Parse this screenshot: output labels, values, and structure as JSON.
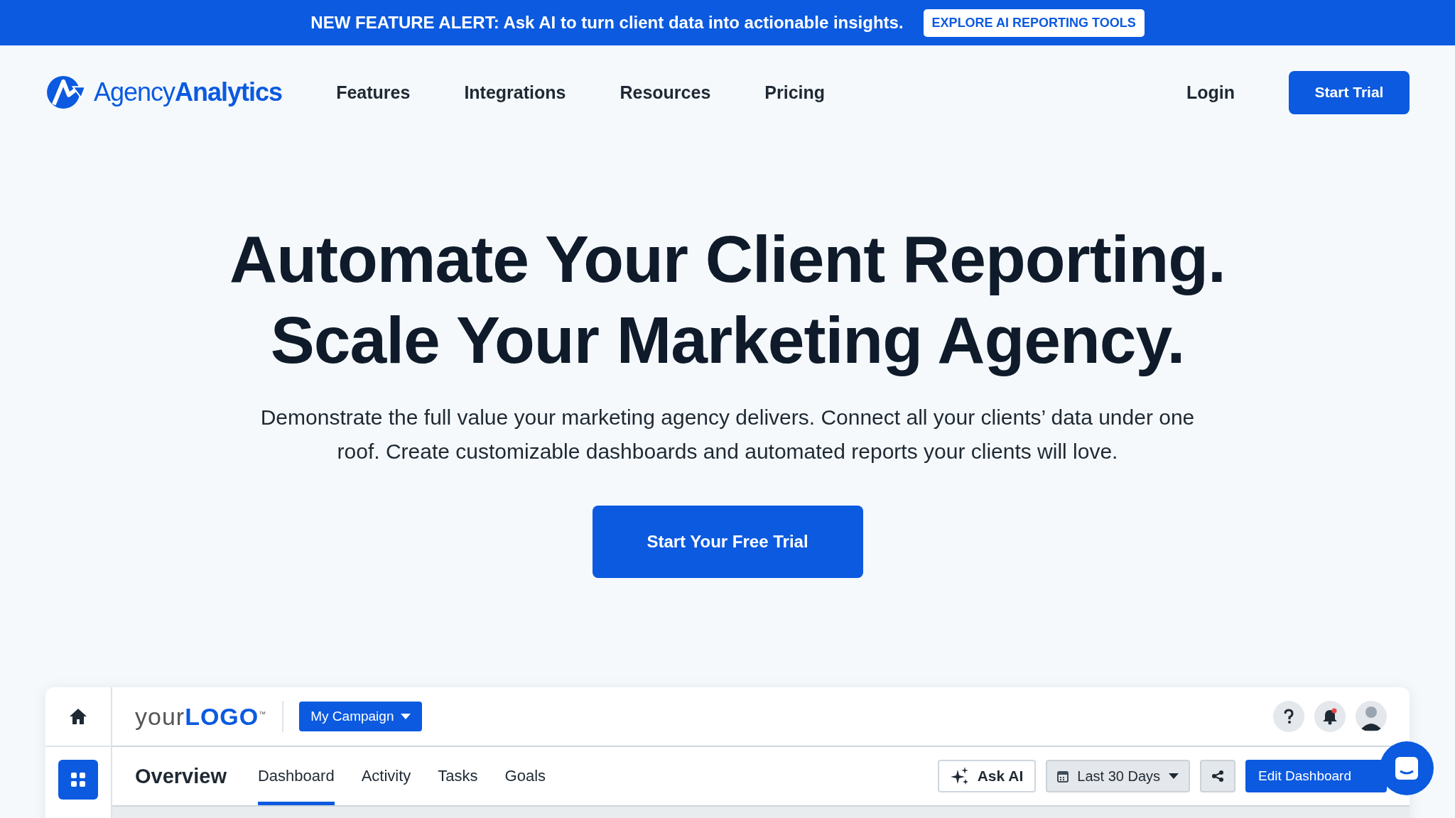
{
  "banner": {
    "text": "NEW FEATURE ALERT: Ask AI to turn client data into actionable insights.",
    "button": "EXPLORE AI REPORTING TOOLS"
  },
  "header": {
    "logo": {
      "light": "Agency",
      "bold": "Analytics"
    },
    "nav": [
      "Features",
      "Integrations",
      "Resources",
      "Pricing"
    ],
    "login": "Login",
    "cta": "Start Trial"
  },
  "hero": {
    "title_lines": [
      "Automate Your Client Reporting.",
      "Scale Your Marketing Agency."
    ],
    "description": "Demonstrate the full value your marketing agency delivers. Connect all your clients’ data under one roof. Create customizable dashboards and automated reports your clients will love.",
    "cta": "Start Your Free Trial"
  },
  "app_preview": {
    "logo": {
      "light": "your",
      "bold": "LOGO",
      "mark": "™"
    },
    "campaign": "My Campaign",
    "page_title": "Overview",
    "tabs": [
      {
        "label": "Dashboard",
        "selected": true
      },
      {
        "label": "Activity",
        "selected": false
      },
      {
        "label": "Tasks",
        "selected": false
      },
      {
        "label": "Goals",
        "selected": false
      }
    ],
    "ask_ai": "Ask AI",
    "date_range": "Last 30 Days",
    "edit": "Edit Dashboard"
  }
}
